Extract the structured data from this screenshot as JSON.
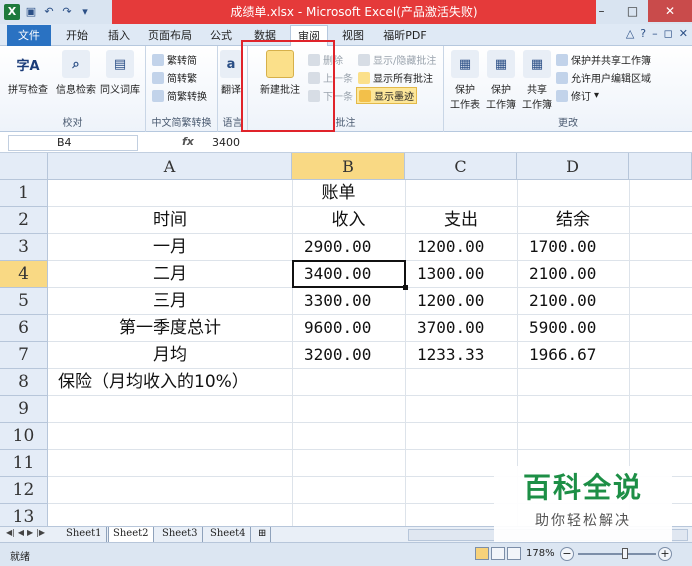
{
  "titlebar": {
    "title": "成绩单.xlsx - Microsoft Excel(产品激活失败)",
    "app_icon": "X",
    "quick_access": [
      "save-icon",
      "undo-icon",
      "redo-icon",
      "customize-icon"
    ],
    "window_buttons": [
      "–",
      "□",
      "✕"
    ]
  },
  "tabs": {
    "file": "文件",
    "items": [
      "开始",
      "插入",
      "页面布局",
      "公式",
      "数据",
      "审阅",
      "视图",
      "福昕PDF"
    ],
    "active": "审阅",
    "right_icons": [
      "△",
      "?",
      "–",
      "◻",
      "✕"
    ]
  },
  "ribbon": {
    "proofing": {
      "label": "校对",
      "spell": "拼写检查",
      "research": "信息检索",
      "thesaurus": "同义词库"
    },
    "chinese": {
      "label": "中文简繁转换",
      "to_trad": "繁转简",
      "to_simp": "简转繁",
      "convert": "简繁转换"
    },
    "language": {
      "label": "语言",
      "translate": "翻译"
    },
    "comments": {
      "label": "批注",
      "new_comment": "新建批注",
      "delete": "删除",
      "previous": "上一条",
      "next": "下一条",
      "show_hide": "显示/隐藏批注",
      "show_all": "显示所有批注",
      "show_ink": "显示墨迹"
    },
    "changes": {
      "label": "更改",
      "protect_sheet": "保护\n工作表",
      "protect_workbook": "保护\n工作簿",
      "share_workbook": "共享\n工作簿",
      "protect_share": "保护并共享工作簿",
      "allow_edit": "允许用户编辑区域",
      "track": "修订"
    }
  },
  "formula_bar": {
    "name_box": "B4",
    "fx": "fx",
    "value": "3400"
  },
  "sheet": {
    "columns": [
      "A",
      "B",
      "C",
      "D"
    ],
    "rows": [
      "1",
      "2",
      "3",
      "4",
      "5",
      "6",
      "7",
      "8",
      "9",
      "10",
      "11",
      "12",
      "13"
    ],
    "selected_cell": "B4",
    "title": "账单",
    "headers": [
      "时间",
      "收入",
      "支出",
      "结余"
    ],
    "data": [
      [
        "一月",
        "2900.00",
        "1200.00",
        "1700.00"
      ],
      [
        "二月",
        "3400.00",
        "1300.00",
        "2100.00"
      ],
      [
        "三月",
        "3300.00",
        "1200.00",
        "2100.00"
      ],
      [
        "第一季度总计",
        "9600.00",
        "3700.00",
        "5900.00"
      ],
      [
        "月均",
        "3200.00",
        "1233.33",
        "1966.67"
      ]
    ],
    "note": "保险（月均收入的10%）"
  },
  "sheet_tabs": {
    "items": [
      "Sheet1",
      "Sheet2",
      "Sheet3",
      "Sheet4"
    ],
    "active": "Sheet2"
  },
  "status": {
    "ready": "就绪",
    "zoom": "178%"
  },
  "watermark": {
    "line1": "百科全说",
    "line2": "助你轻松解决"
  },
  "colors": {
    "file_tab": "#2a72c2",
    "title_highlight": "#e53a3a",
    "selected_header": "#f9d984",
    "annotation_box": "#e0232a",
    "watermark_green": "#1d8f46"
  }
}
